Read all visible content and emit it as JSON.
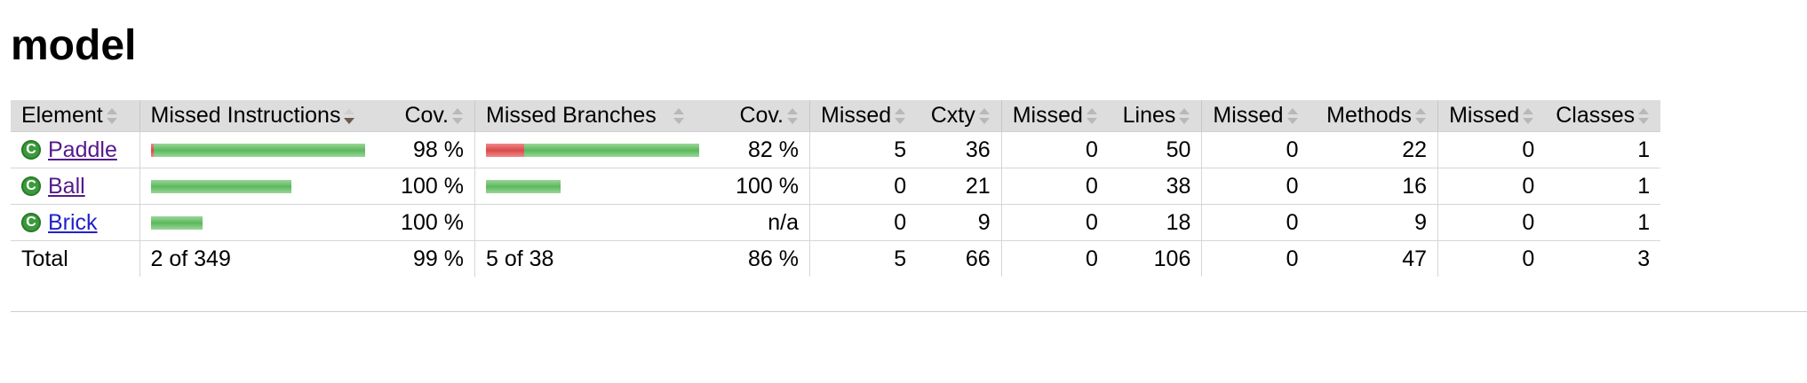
{
  "page": {
    "title": "model"
  },
  "columns": {
    "element": "Element",
    "missed_instructions": "Missed Instructions",
    "instr_cov": "Cov.",
    "missed_branches": "Missed Branches",
    "branch_cov": "Cov.",
    "missed_cxty": "Missed",
    "cxty": "Cxty",
    "missed_lines": "Missed",
    "lines": "Lines",
    "missed_methods": "Missed",
    "methods": "Methods",
    "missed_classes": "Missed",
    "classes": "Classes"
  },
  "rows": [
    {
      "name": "Paddle",
      "instr_missed_fraction": 0.01,
      "instr_covered_fraction": 0.99,
      "instr_cov": "98 %",
      "branch_missed_fraction": 0.18,
      "branch_covered_fraction": 0.82,
      "branch_cov": "82 %",
      "missed_cxty": "5",
      "cxty": "36",
      "missed_lines": "0",
      "lines": "50",
      "missed_methods": "0",
      "methods": "22",
      "missed_classes": "0",
      "classes": "1"
    },
    {
      "name": "Ball",
      "instr_missed_fraction": 0,
      "instr_covered_fraction": 0.66,
      "instr_cov": "100 %",
      "branch_missed_fraction": 0,
      "branch_covered_fraction": 0.35,
      "branch_cov": "100 %",
      "missed_cxty": "0",
      "cxty": "21",
      "missed_lines": "0",
      "lines": "38",
      "missed_methods": "0",
      "methods": "16",
      "missed_classes": "0",
      "classes": "1"
    },
    {
      "name": "Brick",
      "instr_missed_fraction": 0,
      "instr_covered_fraction": 0.24,
      "instr_cov": "100 %",
      "branch_missed_fraction": 0,
      "branch_covered_fraction": 0,
      "branch_cov": "n/a",
      "missed_cxty": "0",
      "cxty": "9",
      "missed_lines": "0",
      "lines": "18",
      "missed_methods": "0",
      "methods": "9",
      "missed_classes": "0",
      "classes": "1"
    }
  ],
  "total": {
    "label": "Total",
    "missed_instructions": "2 of 349",
    "instr_cov": "99 %",
    "missed_branches": "5 of 38",
    "branch_cov": "86 %",
    "missed_cxty": "5",
    "cxty": "66",
    "missed_lines": "0",
    "lines": "106",
    "missed_methods": "0",
    "methods": "47",
    "missed_classes": "0",
    "classes": "3"
  },
  "colors": {
    "covered": "#5cb85c",
    "missed": "#d94a4a",
    "header_bg": "#dddddd",
    "link": "#2222cc",
    "visited_link": "#551a8b"
  },
  "icons": {
    "sort": "sort-arrows-icon",
    "sort_desc": "sort-descending-icon",
    "class": "class-c-icon"
  }
}
